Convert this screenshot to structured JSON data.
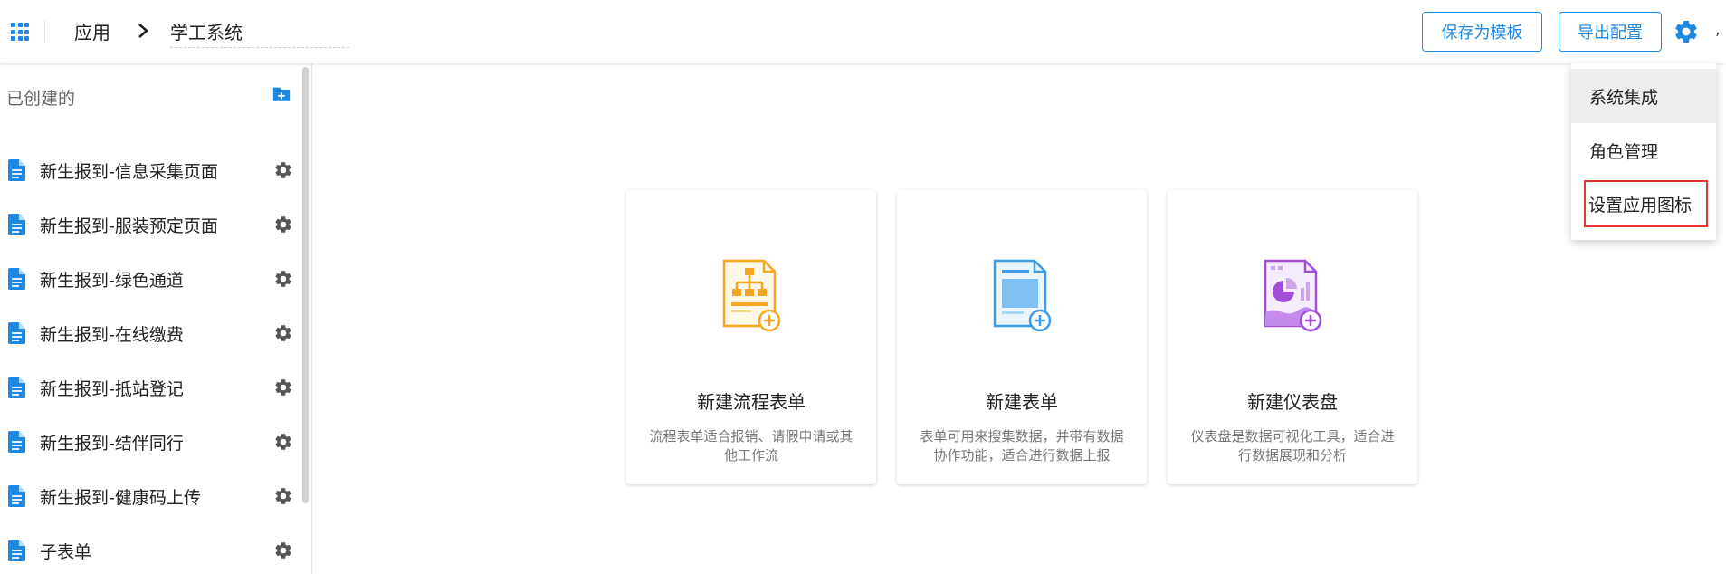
{
  "header": {
    "breadcrumb_app": "应用",
    "breadcrumb_current": "学工系统",
    "save_template_label": "保存为模板",
    "export_config_label": "导出配置",
    "trailing_char": ","
  },
  "sidebar": {
    "title": "已创建的",
    "items": [
      {
        "label": "新生报到-信息采集页面"
      },
      {
        "label": "新生报到-服装预定页面"
      },
      {
        "label": "新生报到-绿色通道"
      },
      {
        "label": "新生报到-在线缴费"
      },
      {
        "label": "新生报到-抵站登记"
      },
      {
        "label": "新生报到-结伴同行"
      },
      {
        "label": "新生报到-健康码上传"
      },
      {
        "label": "子表单"
      }
    ]
  },
  "cards": [
    {
      "title": "新建流程表单",
      "desc": "流程表单适合报销、请假申请或其他工作流",
      "icon": "flow-form-icon",
      "color": "#f5a623"
    },
    {
      "title": "新建表单",
      "desc": "表单可用来搜集数据，并带有数据协作功能，适合进行数据上报",
      "icon": "form-icon",
      "color": "#3d9be9"
    },
    {
      "title": "新建仪表盘",
      "desc": "仪表盘是数据可视化工具，适合进行数据展现和分析",
      "icon": "dashboard-icon",
      "color": "#a24ed8"
    }
  ],
  "dropdown": {
    "items": [
      {
        "label": "系统集成"
      },
      {
        "label": "角色管理"
      },
      {
        "label": "设置应用图标"
      }
    ]
  },
  "colors": {
    "accent": "#1e88e5",
    "highlight_box": "#e53935"
  }
}
